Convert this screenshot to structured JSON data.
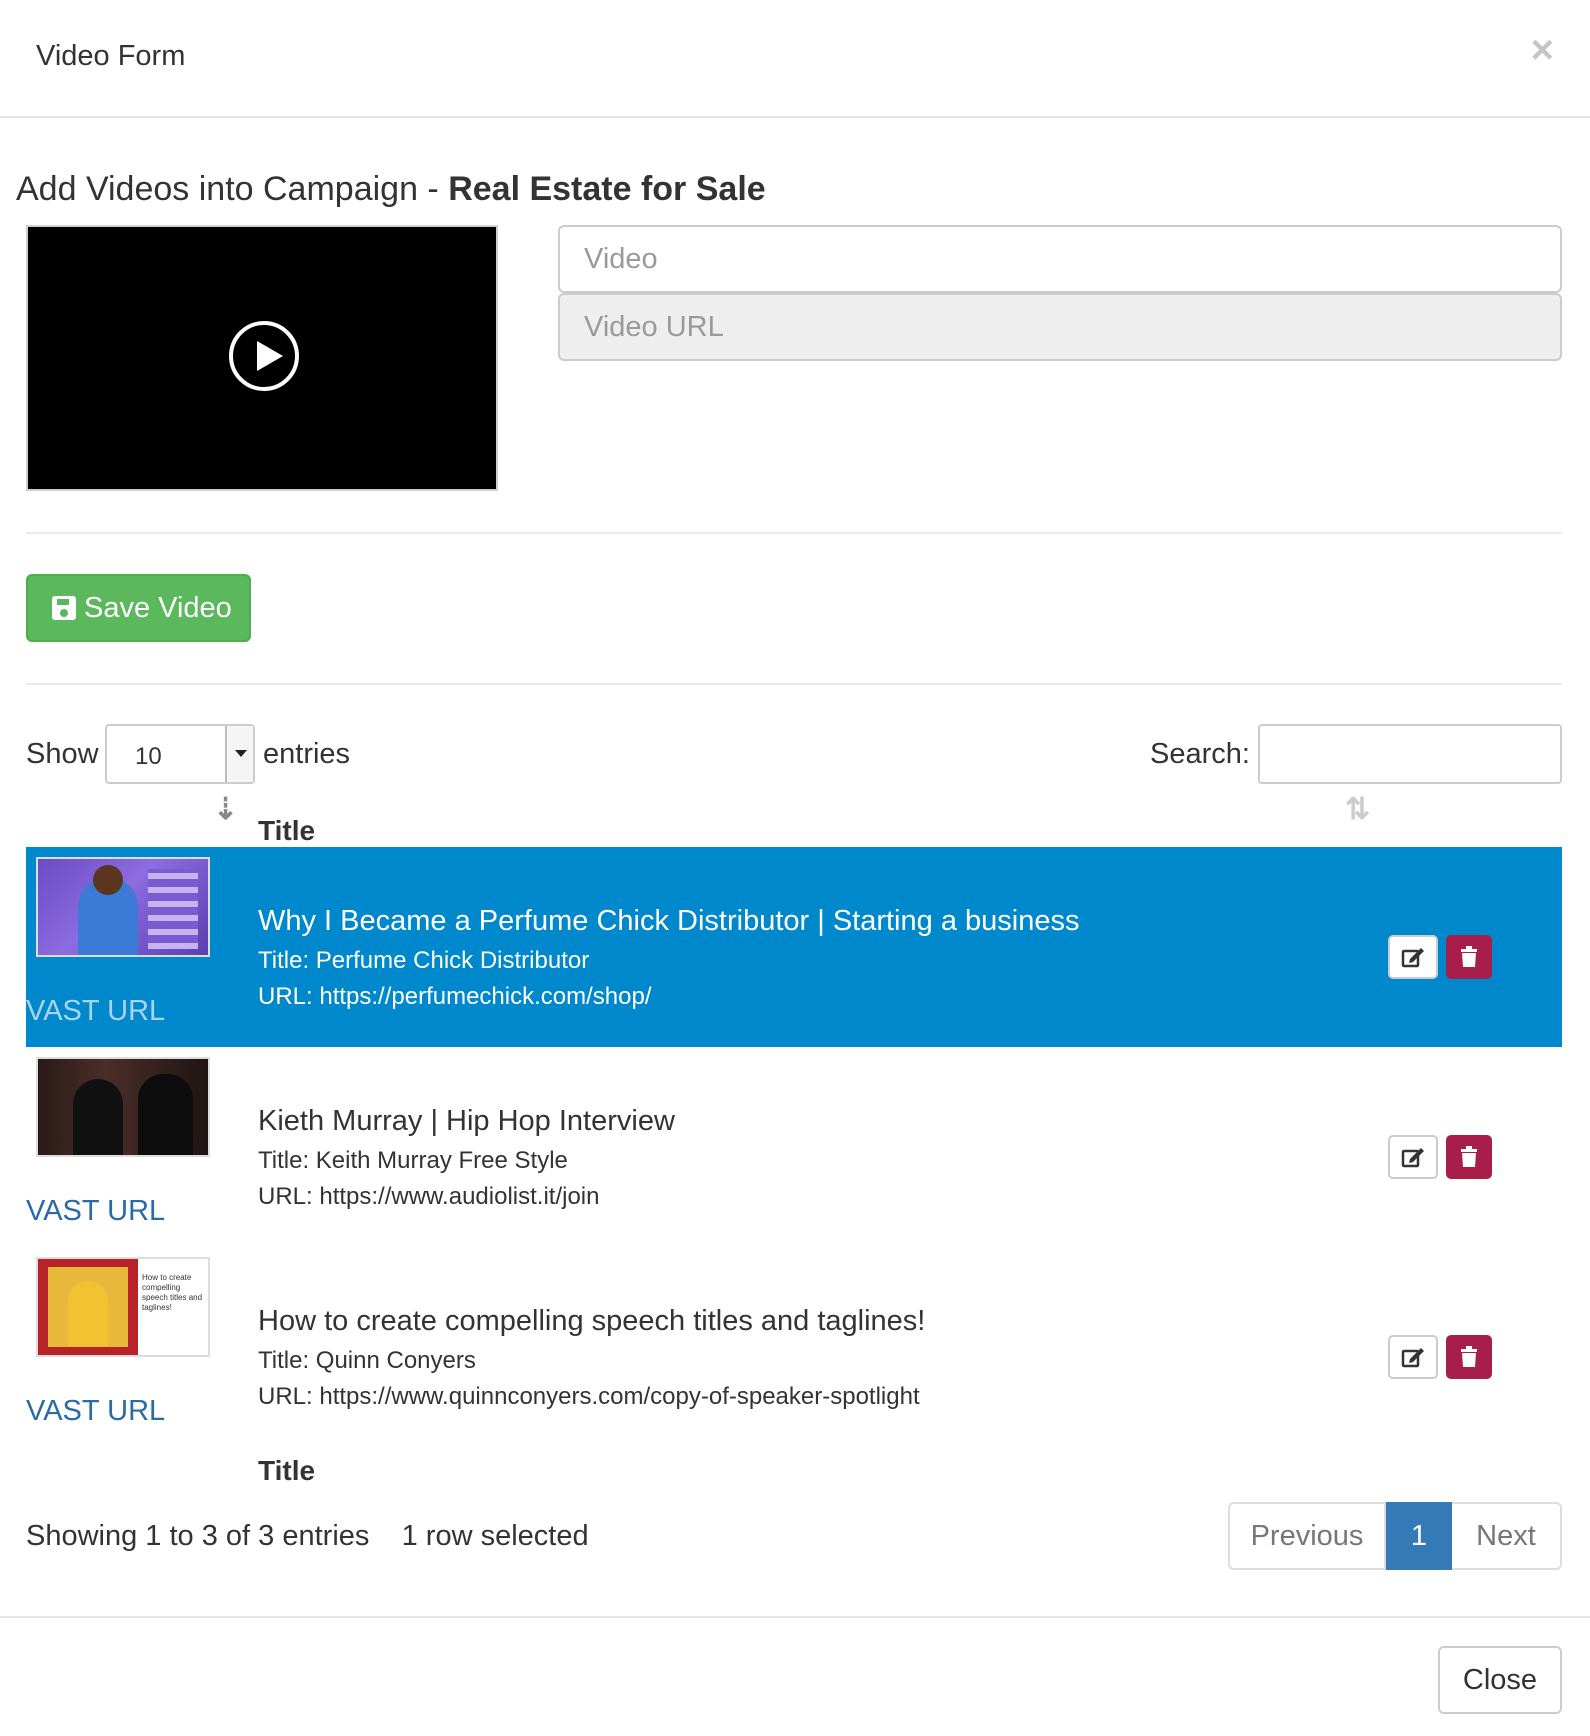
{
  "modal": {
    "title": "Video Form",
    "close_symbol": "×",
    "close_button_label": "Close"
  },
  "section": {
    "title_bold": "Add Videos into Campaign - ",
    "campaign_name": "Real Estate for Sale"
  },
  "form": {
    "video_placeholder": "Video",
    "video_url_placeholder": "Video URL",
    "save_label": "Save Video",
    "save_icon": "floppy-disk-icon",
    "save_color": "#5cb85c"
  },
  "table_controls": {
    "show_label": "Show",
    "page_length": "10",
    "entries_label": "entries",
    "search_label": "Search:",
    "search_value": ""
  },
  "table": {
    "column_header": "Title",
    "column_footer": "Title",
    "selected_row_color": "#0088cc",
    "rows": [
      {
        "title": "Why I Became a Perfume Chick Distributor | Starting a business",
        "sub_title": "Title: Perfume Chick Distributor",
        "url": "URL: https://perfumechick.com/shop/",
        "vast": "VAST URL",
        "selected": true
      },
      {
        "title": "Kieth Murray | Hip Hop Interview",
        "sub_title": "Title: Keith Murray Free Style",
        "url": "URL: https://www.audiolist.it/join",
        "vast": "VAST URL",
        "selected": false
      },
      {
        "title": "How to create compelling speech titles and taglines!",
        "sub_title": "Title: Quinn Conyers",
        "url": "URL: https://www.quinnconyers.com/copy-of-speaker-spotlight",
        "vast": "VAST URL",
        "selected": false,
        "thumb_text": "How to create compelling speech titles and taglines!"
      }
    ]
  },
  "footer_info": {
    "showing": "Showing 1 to 3 of 3 entries",
    "selected": "1 row selected"
  },
  "pagination": {
    "previous": "Previous",
    "current": "1",
    "next": "Next",
    "active_color": "#337ab7"
  }
}
